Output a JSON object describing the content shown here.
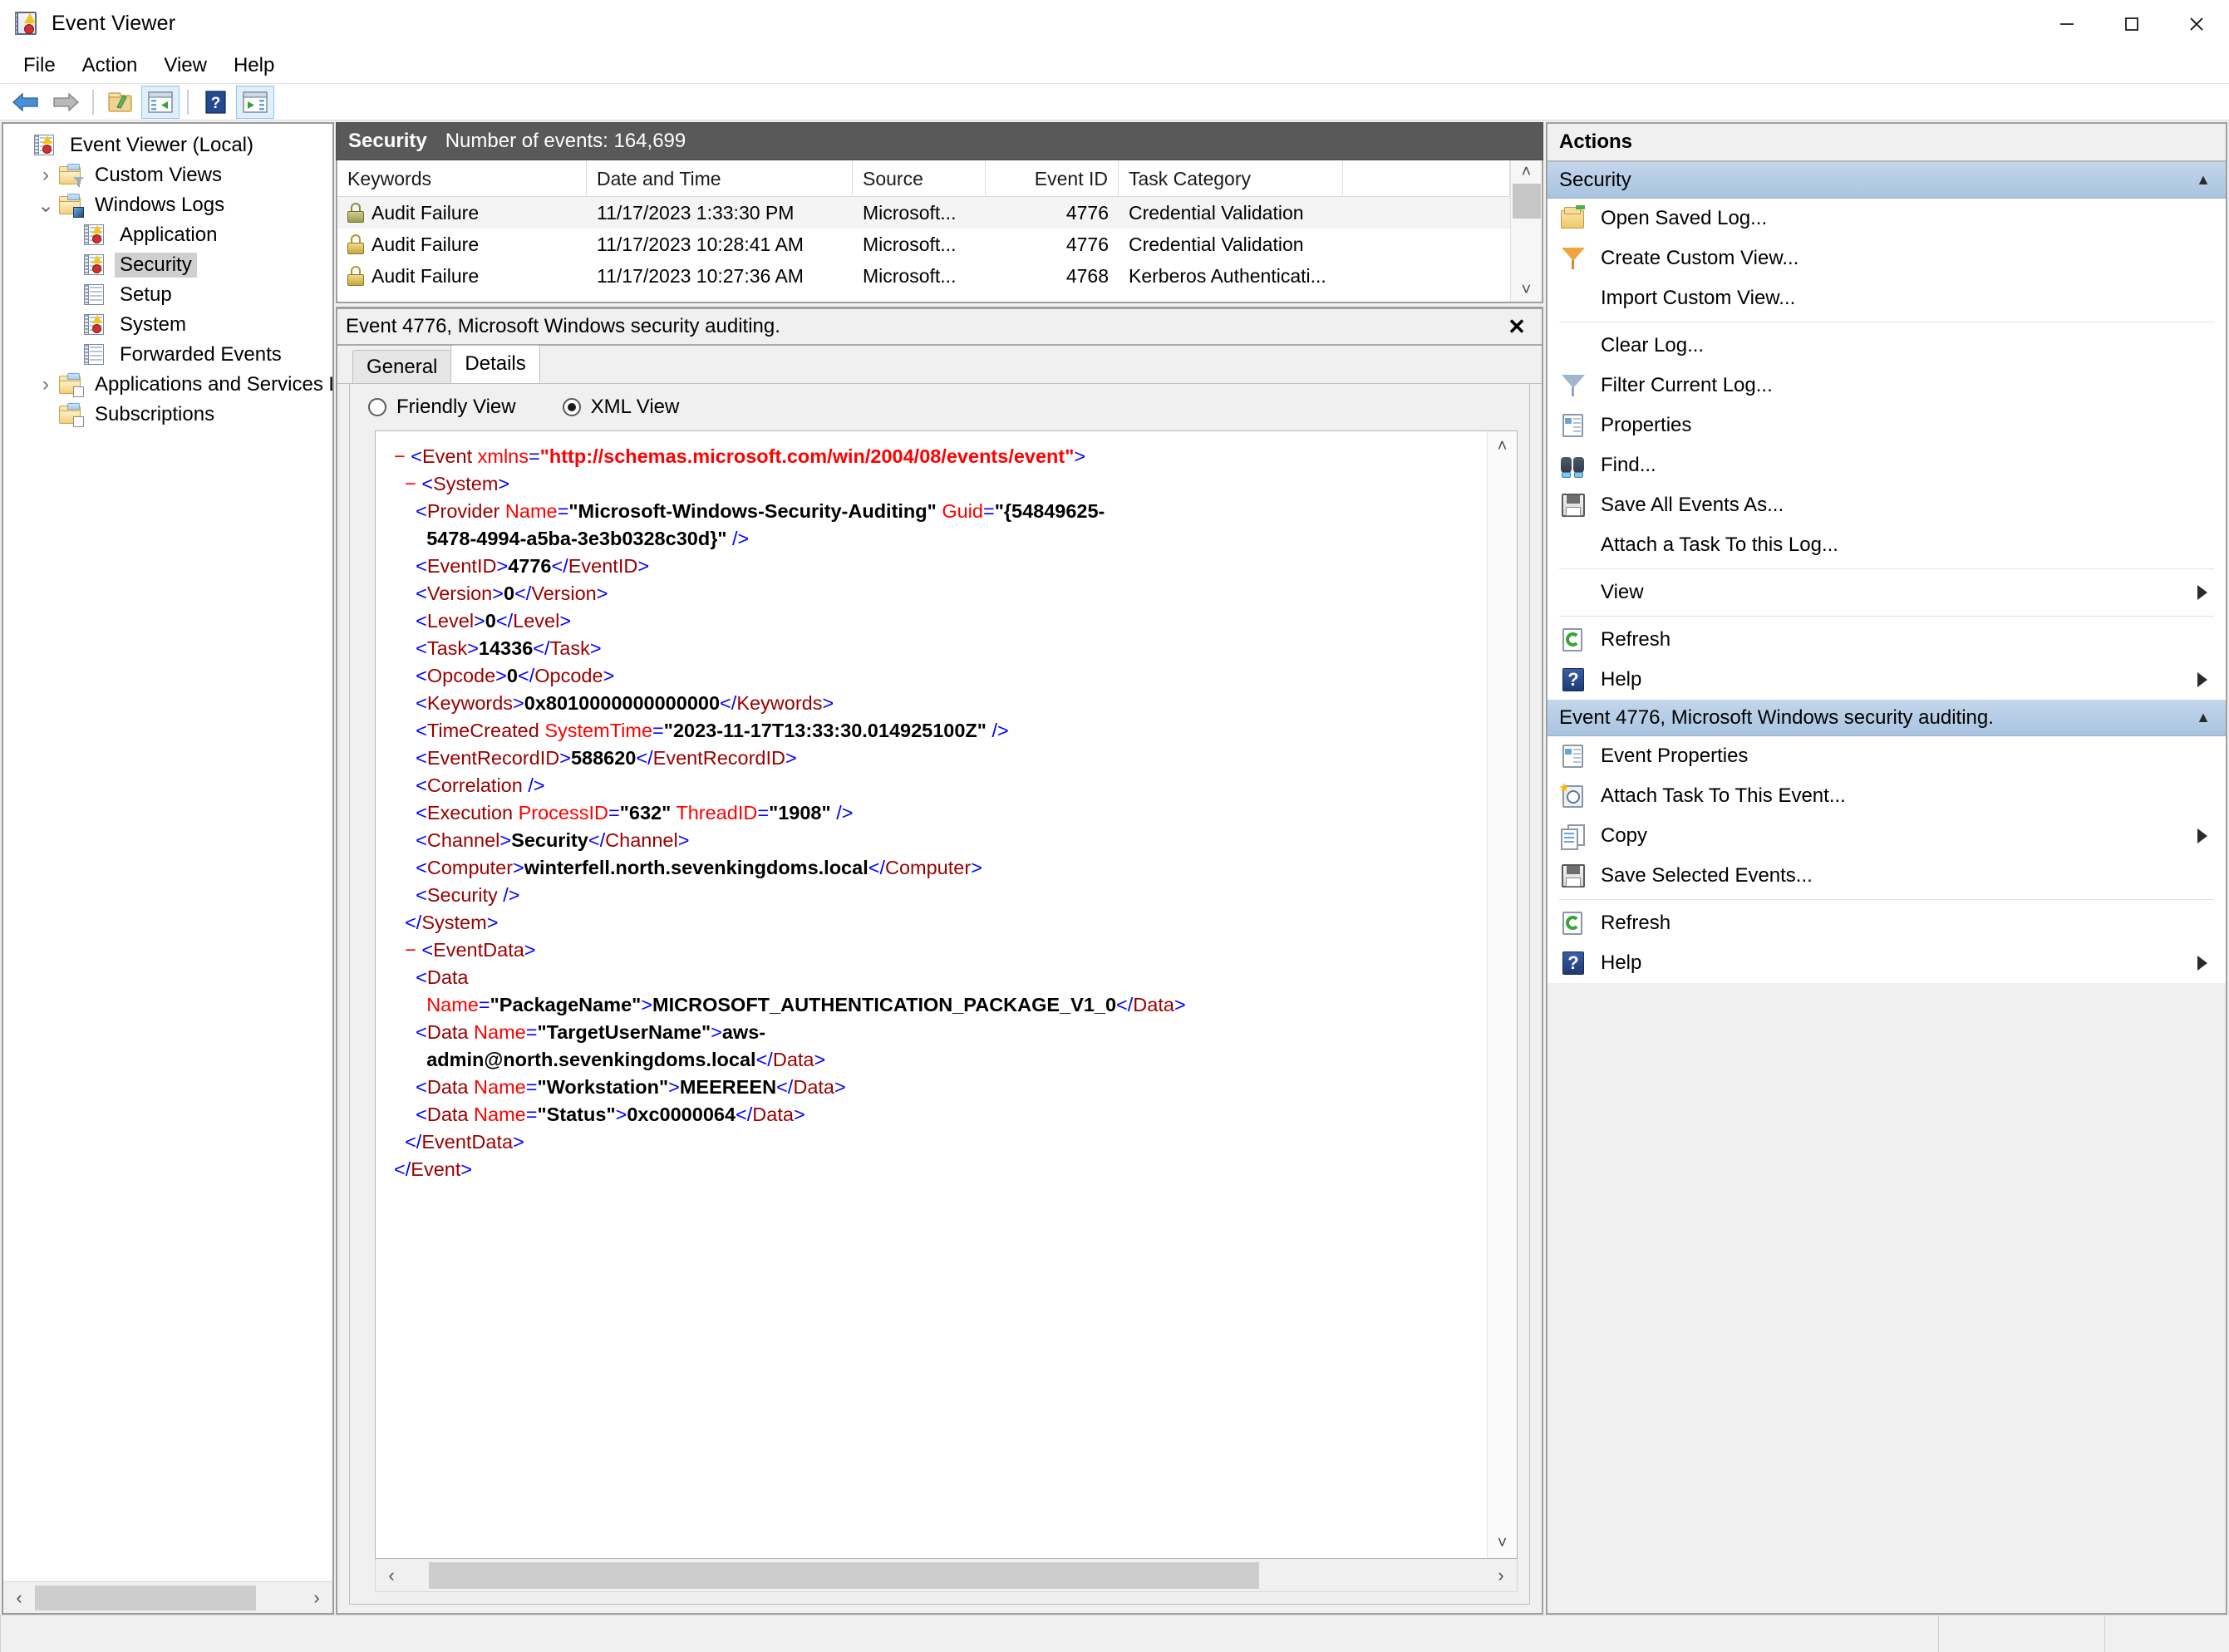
{
  "window": {
    "title": "Event Viewer",
    "icon": "event-viewer-icon",
    "minimize_label": "—",
    "maximize_label": "□",
    "close_label": "✕"
  },
  "menubar": [
    {
      "label": "File"
    },
    {
      "label": "Action"
    },
    {
      "label": "View"
    },
    {
      "label": "Help"
    }
  ],
  "toolbar": [
    {
      "name": "back-icon"
    },
    {
      "name": "forward-icon"
    },
    {
      "name": "open-folder-icon"
    },
    {
      "name": "show-hide-console-tree-icon"
    },
    {
      "name": "help-icon"
    },
    {
      "name": "show-hide-action-pane-icon"
    }
  ],
  "tree": {
    "items": [
      {
        "label": "Event Viewer (Local)",
        "indent": 0,
        "expander": "",
        "icon": "event-log-icon",
        "selected": false
      },
      {
        "label": "Custom Views",
        "indent": 1,
        "expander": "›",
        "icon": "folder-filter-icon",
        "selected": false
      },
      {
        "label": "Windows Logs",
        "indent": 1,
        "expander": "⌄",
        "icon": "folder-windows-icon",
        "selected": false
      },
      {
        "label": "Application",
        "indent": 2,
        "expander": "",
        "icon": "event-log-icon",
        "selected": false
      },
      {
        "label": "Security",
        "indent": 2,
        "expander": "",
        "icon": "event-log-icon",
        "selected": true
      },
      {
        "label": "Setup",
        "indent": 2,
        "expander": "",
        "icon": "event-log-plain-icon",
        "selected": false
      },
      {
        "label": "System",
        "indent": 2,
        "expander": "",
        "icon": "event-log-icon",
        "selected": false
      },
      {
        "label": "Forwarded Events",
        "indent": 2,
        "expander": "",
        "icon": "event-log-plain-icon",
        "selected": false
      },
      {
        "label": "Applications and Services Lo",
        "indent": 1,
        "expander": "›",
        "icon": "folder-apps-icon",
        "selected": false
      },
      {
        "label": "Subscriptions",
        "indent": 1,
        "expander": "",
        "icon": "folder-subscriptions-icon",
        "selected": false
      }
    ]
  },
  "banner": {
    "log_name": "Security",
    "event_count_text": "Number of events: 164,699"
  },
  "event_list": {
    "columns": [
      "Keywords",
      "Date and Time",
      "Source",
      "Event ID",
      "Task Category"
    ],
    "rows": [
      {
        "keywords": "Audit Failure",
        "date": "11/17/2023 1:33:30 PM",
        "source": "Microsoft...",
        "event_id": "4776",
        "task_category": "Credential Validation",
        "selected": true
      },
      {
        "keywords": "Audit Failure",
        "date": "11/17/2023 10:28:41 AM",
        "source": "Microsoft...",
        "event_id": "4776",
        "task_category": "Credential Validation",
        "selected": false
      },
      {
        "keywords": "Audit Failure",
        "date": "11/17/2023 10:27:36 AM",
        "source": "Microsoft...",
        "event_id": "4768",
        "task_category": "Kerberos Authenticati...",
        "selected": false
      }
    ]
  },
  "details": {
    "header": "Event 4776, Microsoft Windows security auditing.",
    "close_label": "✕",
    "tabs": [
      {
        "label": "General",
        "active": false
      },
      {
        "label": "Details",
        "active": true
      }
    ],
    "view_modes": [
      {
        "label": "Friendly View",
        "selected": false
      },
      {
        "label": "XML View",
        "selected": true
      }
    ]
  },
  "xml": {
    "namespace": "http://schemas.microsoft.com/win/2004/08/events/event",
    "provider_name": "Microsoft-Windows-Security-Auditing",
    "provider_guid_line1": "{54849625-",
    "provider_guid_line2": "5478-4994-a5ba-3e3b0328c30d}",
    "event_id": "4776",
    "version": "0",
    "level": "0",
    "task": "14336",
    "opcode": "0",
    "keywords": "0x8010000000000000",
    "time_created": "2023-11-17T13:33:30.014925100Z",
    "event_record_id": "588620",
    "execution_process_id": "632",
    "execution_thread_id": "1908",
    "channel": "Security",
    "computer": "winterfell.north.sevenkingdoms.local",
    "data": [
      {
        "name": "PackageName",
        "value": "MICROSOFT_AUTHENTICATION_PACKAGE_V1_0"
      },
      {
        "name": "TargetUserName",
        "value_line1": "aws-",
        "value_line2": "admin@north.sevenkingdoms.local"
      },
      {
        "name": "Workstation",
        "value": "MEEREEN"
      },
      {
        "name": "Status",
        "value": "0xc0000064"
      }
    ],
    "colors": {
      "bracket": "#0000ff",
      "tag": "#990000",
      "attribute": "#ff0000",
      "value": "#000000",
      "url": "#ff0000"
    }
  },
  "actions": {
    "title": "Actions",
    "groups": [
      {
        "header": "Security",
        "collapse_caret": "▲",
        "items": [
          {
            "label": "Open Saved Log...",
            "icon": "open-saved-log-icon",
            "submenu": false,
            "separator_after": false
          },
          {
            "label": "Create Custom View...",
            "icon": "create-custom-view-icon",
            "submenu": false,
            "separator_after": false
          },
          {
            "label": "Import Custom View...",
            "icon": "none",
            "submenu": false,
            "separator_after": true
          },
          {
            "label": "Clear Log...",
            "icon": "none",
            "submenu": false,
            "separator_after": false
          },
          {
            "label": "Filter Current Log...",
            "icon": "filter-icon",
            "submenu": false,
            "separator_after": false
          },
          {
            "label": "Properties",
            "icon": "properties-icon",
            "submenu": false,
            "separator_after": false
          },
          {
            "label": "Find...",
            "icon": "find-icon",
            "submenu": false,
            "separator_after": false
          },
          {
            "label": "Save All Events As...",
            "icon": "save-icon",
            "submenu": false,
            "separator_after": false
          },
          {
            "label": "Attach a Task To this Log...",
            "icon": "none",
            "submenu": false,
            "separator_after": true
          },
          {
            "label": "View",
            "icon": "none",
            "submenu": true,
            "separator_after": true
          },
          {
            "label": "Refresh",
            "icon": "refresh-icon",
            "submenu": false,
            "separator_after": false
          },
          {
            "label": "Help",
            "icon": "help-icon",
            "submenu": true,
            "separator_after": false
          }
        ]
      },
      {
        "header": "Event 4776, Microsoft Windows security auditing.",
        "collapse_caret": "▲",
        "items": [
          {
            "label": "Event Properties",
            "icon": "properties-icon",
            "submenu": false,
            "separator_after": false
          },
          {
            "label": "Attach Task To This Event...",
            "icon": "attach-task-icon",
            "submenu": false,
            "separator_after": false
          },
          {
            "label": "Copy",
            "icon": "copy-icon",
            "submenu": true,
            "separator_after": false
          },
          {
            "label": "Save Selected Events...",
            "icon": "save-icon",
            "submenu": false,
            "separator_after": true
          },
          {
            "label": "Refresh",
            "icon": "refresh-icon",
            "submenu": false,
            "separator_after": false
          },
          {
            "label": "Help",
            "icon": "help-icon",
            "submenu": true,
            "separator_after": false
          }
        ]
      }
    ]
  },
  "scrollbars": {
    "left_arrow": "‹",
    "right_arrow": "›",
    "up_arrow": "˄",
    "down_arrow": "˅"
  },
  "statusbar": {
    "text": ""
  }
}
